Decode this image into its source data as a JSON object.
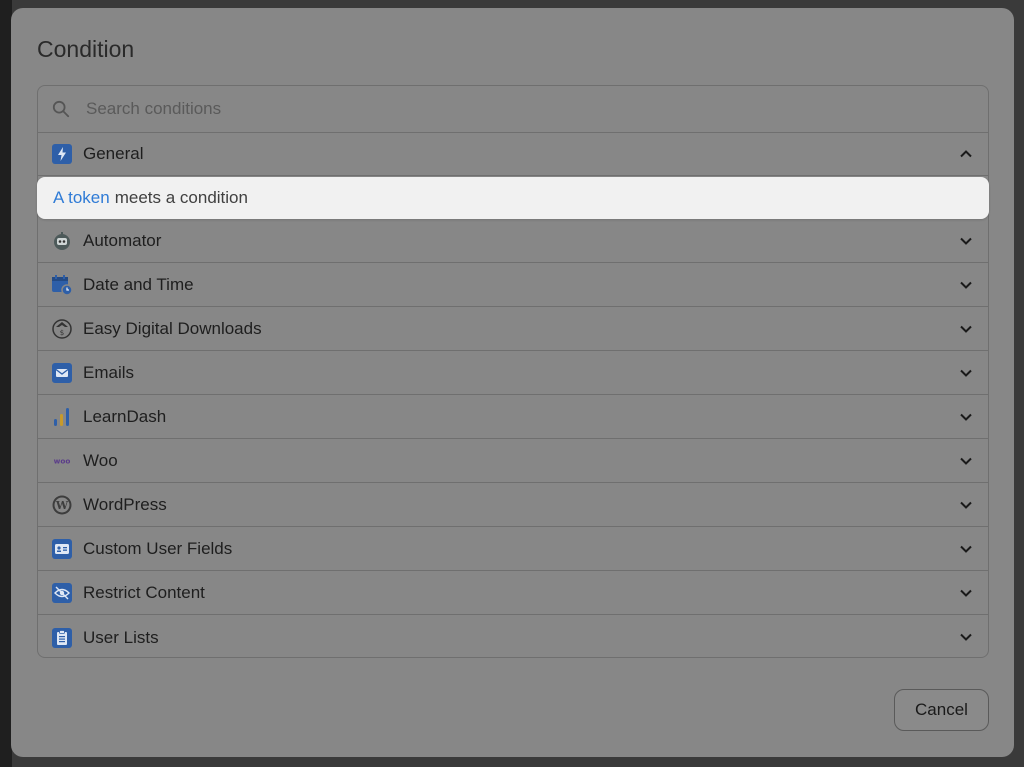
{
  "dialog": {
    "title": "Condition",
    "search_placeholder": "Search conditions",
    "cancel_label": "Cancel"
  },
  "groups": [
    {
      "label": "General",
      "expanded": true,
      "icon": "bolt-icon"
    },
    {
      "label": "Automator",
      "expanded": false,
      "icon": "robot-icon"
    },
    {
      "label": "Date and Time",
      "expanded": false,
      "icon": "calendar-clock-icon"
    },
    {
      "label": "Easy Digital Downloads",
      "expanded": false,
      "icon": "edd-icon"
    },
    {
      "label": "Emails",
      "expanded": false,
      "icon": "envelope-icon"
    },
    {
      "label": "LearnDash",
      "expanded": false,
      "icon": "learndash-icon"
    },
    {
      "label": "Woo",
      "expanded": false,
      "icon": "woo-icon"
    },
    {
      "label": "WordPress",
      "expanded": false,
      "icon": "wordpress-icon"
    },
    {
      "label": "Custom User Fields",
      "expanded": false,
      "icon": "id-card-icon"
    },
    {
      "label": "Restrict Content",
      "expanded": false,
      "icon": "eye-slash-icon"
    },
    {
      "label": "User Lists",
      "expanded": false,
      "icon": "clipboard-icon"
    }
  ],
  "general_items": [
    {
      "token": "A token",
      "text": "meets a condition"
    }
  ],
  "colors": {
    "accent": "#2f7bd6",
    "icon_blue": "#2e6fc4",
    "woo_purple": "#7f54b3"
  }
}
